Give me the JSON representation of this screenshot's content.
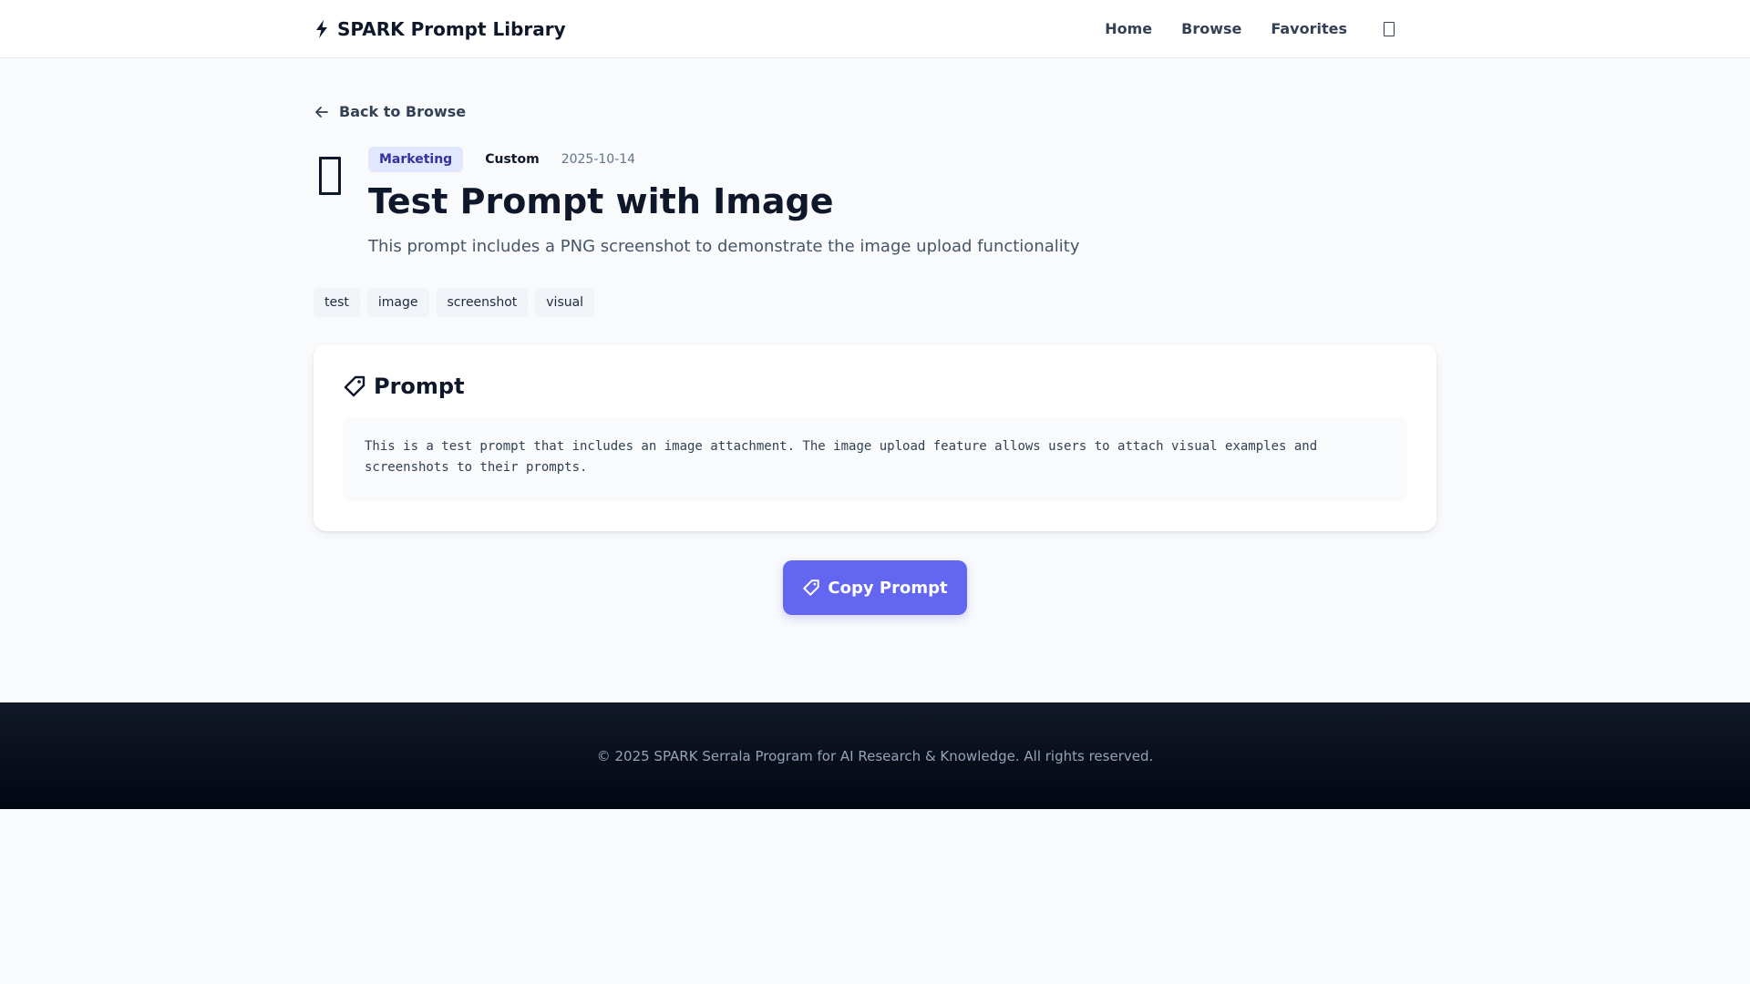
{
  "header": {
    "brand_title": "SPARK Prompt Library",
    "brand_icon": "lightning-bolt-icon",
    "nav": {
      "home": "Home",
      "browse": "Browse",
      "favorites": "Favorites"
    },
    "theme_icon": "theme-toggle-icon"
  },
  "back_link": {
    "label": "Back to Browse",
    "icon": "arrow-left-icon"
  },
  "prompt": {
    "category": "Marketing",
    "type": "Custom",
    "date": "2025-10-14",
    "title": "Test Prompt with Image",
    "description": "This prompt includes a PNG screenshot to demonstrate the image upload functionality",
    "tags": [
      "test",
      "image",
      "screenshot",
      "visual"
    ],
    "section_title": "Prompt",
    "section_icon": "tag-icon",
    "body": "This is a test prompt that includes an image attachment. The image upload feature allows users to attach visual examples and\nscreenshots to their prompts."
  },
  "actions": {
    "copy_label": "Copy Prompt"
  },
  "footer": {
    "text": "© 2025 SPARK Serrala Program for AI Research & Knowledge. All rights reserved."
  },
  "colors": {
    "accent": "#6366f1",
    "category_bg": "#e0e7ff",
    "category_text": "#3730a3",
    "page_bg": "#f8fafc",
    "footer_bg": "#0b1220"
  }
}
